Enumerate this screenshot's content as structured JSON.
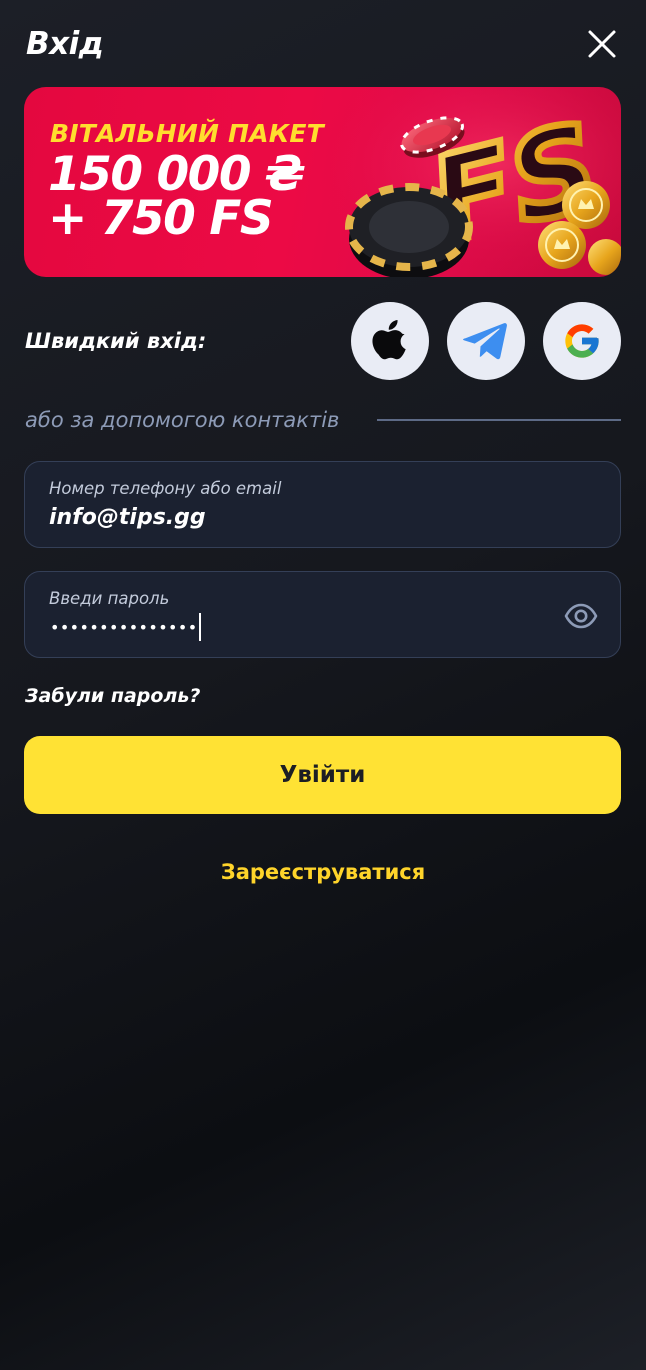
{
  "header": {
    "title": "Вхід",
    "close_icon": "close-icon"
  },
  "banner": {
    "line1": "ВІТАЛЬНИЙ ПАКЕТ",
    "line2": "150 000 ₴",
    "line3": "+ 750 FS",
    "art_text": "FS"
  },
  "quick_login": {
    "label": "Швидкий вхід:",
    "providers": [
      "apple-icon",
      "telegram-icon",
      "google-icon"
    ]
  },
  "divider": {
    "text": "або за допомогою контактів"
  },
  "login_field": {
    "label": "Номер телефону або email",
    "value": "info@tips.gg"
  },
  "password_field": {
    "label": "Введи пароль",
    "masked_value": "•••••••••••••••",
    "toggle_icon": "eye-icon"
  },
  "forgot_password": "Забули пароль?",
  "submit_label": "Увійти",
  "register_label": "Зареєструватися",
  "colors": {
    "accent": "#ffe234",
    "link": "#ffd42a",
    "banner_red": "#e4083f",
    "banner_yellow": "#ffde2e",
    "field_border": "#343f57",
    "muted_text": "#8d9bb7"
  }
}
